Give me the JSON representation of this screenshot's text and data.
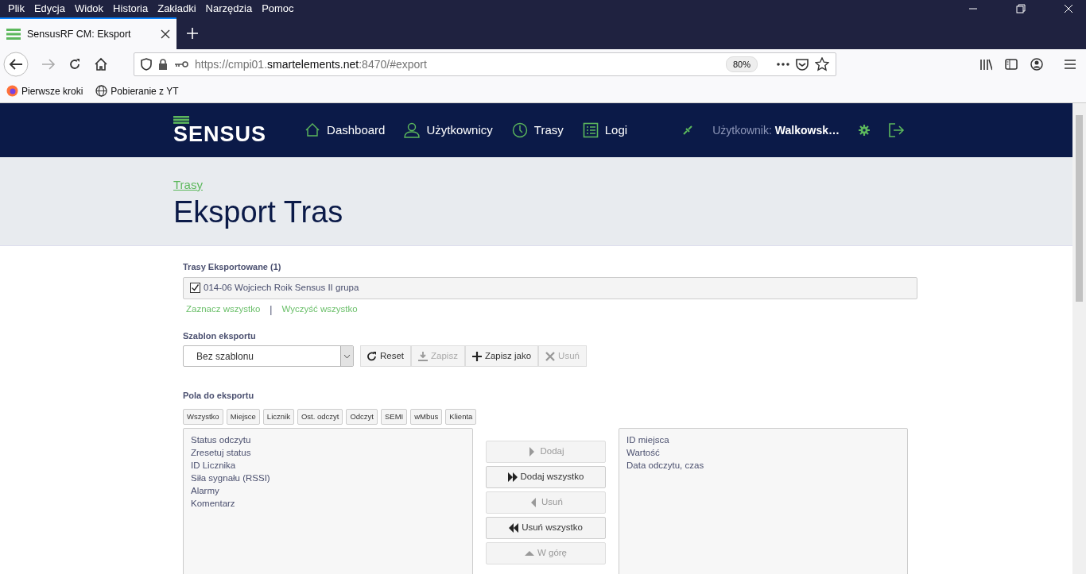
{
  "browser": {
    "menu": [
      "Plik",
      "Edycja",
      "Widok",
      "Historia",
      "Zakładki",
      "Narzędzia",
      "Pomoc"
    ],
    "tab": {
      "title": "SensusRF CM: Eksport",
      "selected": true
    },
    "url": {
      "prefix": "https://cmpi01.",
      "domain": "smartelements.net",
      "suffix": ":8470/#export"
    },
    "zoom": "80%",
    "bookmarks": [
      {
        "label": "Pierwsze kroki",
        "kind": "firefox"
      },
      {
        "label": "Pobieranie z YT",
        "kind": "globe"
      }
    ]
  },
  "app": {
    "logo": "SENSUS",
    "nav": [
      {
        "label": "Dashboard",
        "kind": "home"
      },
      {
        "label": "Użytkownicy",
        "kind": "user"
      },
      {
        "label": "Trasy",
        "kind": "clock"
      },
      {
        "label": "Logi",
        "kind": "list"
      }
    ],
    "user_label": "Użytkownik:",
    "user_name": "Walkowsk…"
  },
  "breadcrumb": "Trasy",
  "title": "Eksport Tras",
  "exported": {
    "heading": "Trasy Eksportowane (1)",
    "items": [
      {
        "label": "014-06 Wojciech Roik Sensus II grupa",
        "checked": true
      }
    ],
    "links": [
      "Zaznacz wszystko",
      "Wyczyść wszystko"
    ],
    "separator": "|"
  },
  "template": {
    "heading": "Szablon eksportu",
    "value": "Bez szablonu",
    "buttons": [
      {
        "label": "Reset",
        "kind": "refresh",
        "disabled": false
      },
      {
        "label": "Zapisz",
        "kind": "download",
        "disabled": true
      },
      {
        "label": "Zapisz jako",
        "kind": "plus",
        "disabled": false
      },
      {
        "label": "Usuń",
        "kind": "x",
        "disabled": true
      }
    ]
  },
  "fields": {
    "heading": "Pola do eksportu",
    "filters": [
      "Wszystko",
      "Miejsce",
      "Licznik",
      "Ost. odczyt",
      "Odczyt",
      "SEMI",
      "wMbus",
      "Klienta"
    ],
    "available": [
      "Status odczytu",
      "Zresetuj status",
      "ID Licznika",
      "Siła sygnału (RSSI)",
      "Alarmy",
      "Komentarz"
    ],
    "move_buttons": [
      {
        "label": "Dodaj",
        "kind": "right",
        "disabled": true
      },
      {
        "label": "Dodaj wszystko",
        "kind": "right2",
        "disabled": false
      },
      {
        "label": "Usuń",
        "kind": "left",
        "disabled": true
      },
      {
        "label": "Usuń wszystko",
        "kind": "left2",
        "disabled": false
      },
      {
        "label": "W górę",
        "kind": "up",
        "disabled": true
      }
    ],
    "selected": [
      "ID miejsca",
      "Wartość",
      "Data odczytu, czas"
    ]
  }
}
